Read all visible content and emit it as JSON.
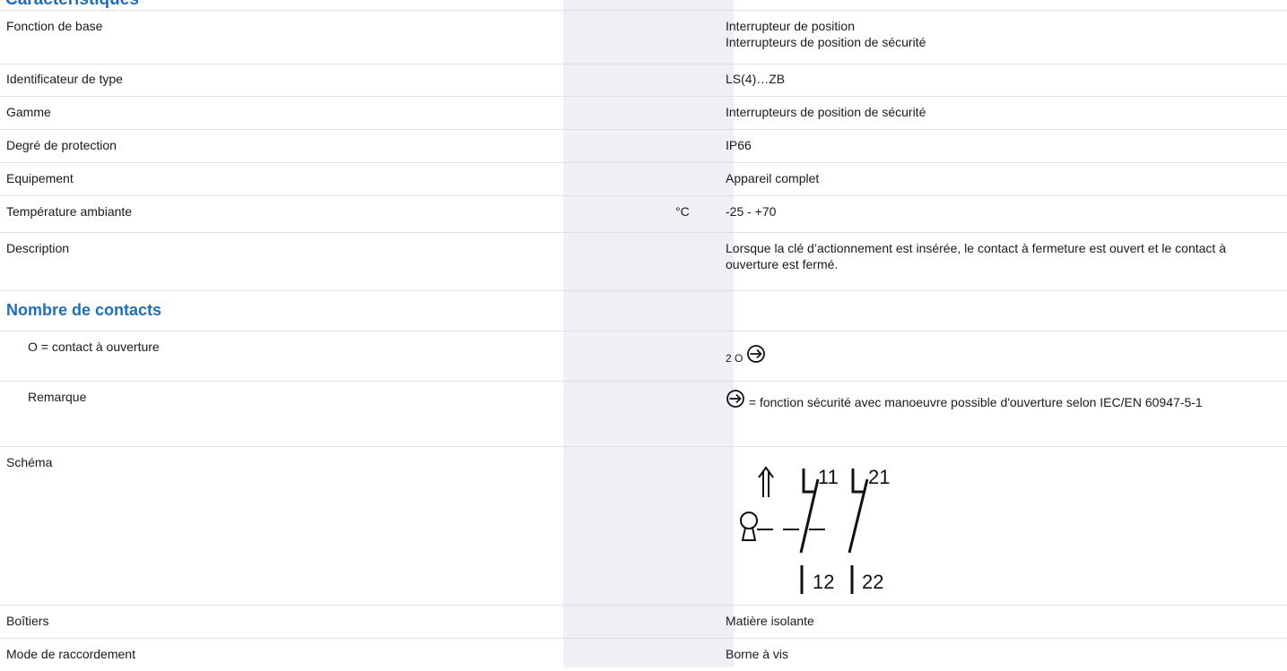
{
  "header": {
    "title": "Caractéristiques"
  },
  "rows": [
    {
      "label": "Fonction de base",
      "value": "Interrupteur de position",
      "value2": "Interrupteurs de position de sécurité"
    },
    {
      "label": "Identificateur de type",
      "value": "LS(4)…ZB"
    },
    {
      "label": "Gamme",
      "value": "Interrupteurs de position de sécurité"
    },
    {
      "label": "Degré de protection",
      "value": "IP66"
    },
    {
      "label": "Equipement",
      "value": "Appareil complet"
    },
    {
      "label": "Température ambiante",
      "unit": "°C",
      "value": "-25 - +70"
    },
    {
      "label": "Description",
      "value": "Lorsque la clé d’actionnement est insérée, le contact à fermeture est ouvert et le contact à ouverture est fermé."
    }
  ],
  "contacts": {
    "section_title": "Nombre de contacts",
    "nc_label": "O = contact à ouverture",
    "nc_value": "2 O",
    "remark_label": "Remarque",
    "remark_value": "= fonction sécurité avec manoeuvre possible d'ouverture selon IEC/EN 60947-5-1",
    "symbol_icon": "positive-opening-icon"
  },
  "schema": {
    "label": "Schéma",
    "terminals": [
      "11",
      "21",
      "12",
      "22"
    ]
  },
  "rows_bottom": [
    {
      "label": "Boîtiers",
      "value": "Matière isolante"
    },
    {
      "label": "Mode de raccordement",
      "value": "Borne à vis"
    }
  ]
}
